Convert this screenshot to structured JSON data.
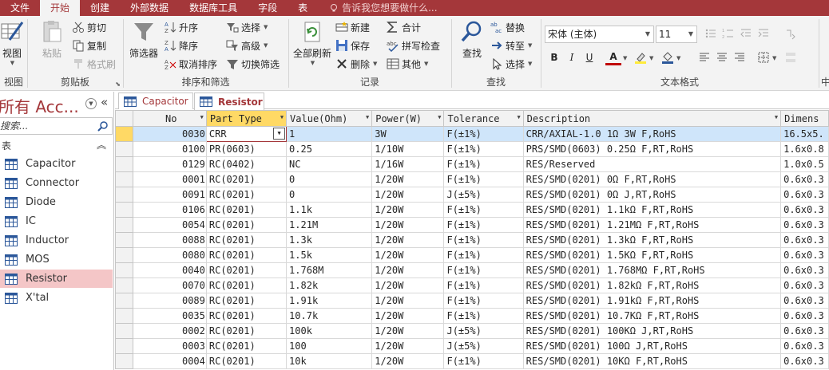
{
  "ribbon_tabs": [
    "文件",
    "开始",
    "创建",
    "外部数据",
    "数据库工具",
    "字段",
    "表"
  ],
  "tell_me": "告诉我您想要做什么...",
  "groups": {
    "view": {
      "label": "视图",
      "btn": "视图"
    },
    "clipboard": {
      "label": "剪贴板",
      "paste": "粘贴",
      "cut": "剪切",
      "copy": "复制",
      "painter": "格式刷"
    },
    "sortfilter": {
      "label": "排序和筛选",
      "filter": "筛选器",
      "asc": "升序",
      "desc": "降序",
      "remove": "取消排序",
      "select": "选择",
      "advanced": "高级",
      "toggle": "切换筛选"
    },
    "records": {
      "label": "记录",
      "refresh": "全部刷新",
      "new": "新建",
      "save": "保存",
      "delete": "删除",
      "totals": "合计",
      "spelling": "拼写检查",
      "more": "其他"
    },
    "find": {
      "label": "查找",
      "find": "查找",
      "replace": "替换",
      "goto": "转至",
      "select": "选择"
    },
    "textfmt": {
      "label": "文本格式",
      "font": "宋体 (主体)",
      "size": "11",
      "bold": "B",
      "italic": "I",
      "underline": "U",
      "fontcolor": "A"
    },
    "chinese": {
      "label": "中"
    }
  },
  "nav": {
    "title": "所有 Acc...",
    "search_placeholder": "搜索...",
    "group": "表",
    "items": [
      "Capacitor",
      "Connector",
      "Diode",
      "IC",
      "Inductor",
      "MOS",
      "Resistor",
      "X'tal"
    ],
    "selected": "Resistor"
  },
  "doc_tabs": [
    "Capacitor",
    "Resistor"
  ],
  "active_doc_tab": "Resistor",
  "table": {
    "headers": [
      "No",
      "Part Type",
      "Value(Ohm)",
      "Power(W)",
      "Tolerance",
      "Description",
      "Dimens"
    ],
    "rows": [
      [
        "0030",
        "CRR",
        "1",
        "3W",
        "F(±1%)",
        "CRR/AXIAL-1.0 1Ω 3W F,RoHS",
        "16.5x5."
      ],
      [
        "0100",
        "PR(0603)",
        "0.25",
        "1/10W",
        "F(±1%)",
        "PRS/SMD(0603) 0.25Ω F,RT,RoHS",
        "1.6x0.8"
      ],
      [
        "0129",
        "RC(0402)",
        "NC",
        "1/16W",
        "F(±1%)",
        "RES/Reserved",
        "1.0x0.5"
      ],
      [
        "0001",
        "RC(0201)",
        "0",
        "1/20W",
        "F(±1%)",
        "RES/SMD(0201) 0Ω F,RT,RoHS",
        "0.6x0.3"
      ],
      [
        "0091",
        "RC(0201)",
        "0",
        "1/20W",
        "J(±5%)",
        "RES/SMD(0201) 0Ω J,RT,RoHS",
        "0.6x0.3"
      ],
      [
        "0106",
        "RC(0201)",
        "1.1k",
        "1/20W",
        "F(±1%)",
        "RES/SMD(0201) 1.1kΩ F,RT,RoHS",
        "0.6x0.3"
      ],
      [
        "0054",
        "RC(0201)",
        "1.21M",
        "1/20W",
        "F(±1%)",
        "RES/SMD(0201) 1.21MΩ F,RT,RoHS",
        "0.6x0.3"
      ],
      [
        "0088",
        "RC(0201)",
        "1.3k",
        "1/20W",
        "F(±1%)",
        "RES/SMD(0201) 1.3kΩ F,RT,RoHS",
        "0.6x0.3"
      ],
      [
        "0080",
        "RC(0201)",
        "1.5k",
        "1/20W",
        "F(±1%)",
        "RES/SMD(0201) 1.5KΩ F,RT,RoHS",
        "0.6x0.3"
      ],
      [
        "0040",
        "RC(0201)",
        "1.768M",
        "1/20W",
        "F(±1%)",
        "RES/SMD(0201) 1.768MΩ F,RT,RoHS",
        "0.6x0.3"
      ],
      [
        "0070",
        "RC(0201)",
        "1.82k",
        "1/20W",
        "F(±1%)",
        "RES/SMD(0201) 1.82kΩ F,RT,RoHS",
        "0.6x0.3"
      ],
      [
        "0089",
        "RC(0201)",
        "1.91k",
        "1/20W",
        "F(±1%)",
        "RES/SMD(0201) 1.91kΩ F,RT,RoHS",
        "0.6x0.3"
      ],
      [
        "0035",
        "RC(0201)",
        "10.7k",
        "1/20W",
        "F(±1%)",
        "RES/SMD(0201) 10.7KΩ F,RT,RoHS",
        "0.6x0.3"
      ],
      [
        "0002",
        "RC(0201)",
        "100k",
        "1/20W",
        "J(±5%)",
        "RES/SMD(0201) 100KΩ J,RT,RoHS",
        "0.6x0.3"
      ],
      [
        "0003",
        "RC(0201)",
        "100",
        "1/20W",
        "J(±5%)",
        "RES/SMD(0201) 100Ω J,RT,RoHS",
        "0.6x0.3"
      ],
      [
        "0004",
        "RC(0201)",
        "10k",
        "1/20W",
        "F(±1%)",
        "RES/SMD(0201) 10KΩ F,RT,RoHS",
        "0.6x0.3"
      ]
    ]
  },
  "colors": {
    "accent": "#a4373a",
    "selected_nav": "#f4c6c7",
    "current_row": "#cfe5fa",
    "selected_header": "#ffd965"
  }
}
